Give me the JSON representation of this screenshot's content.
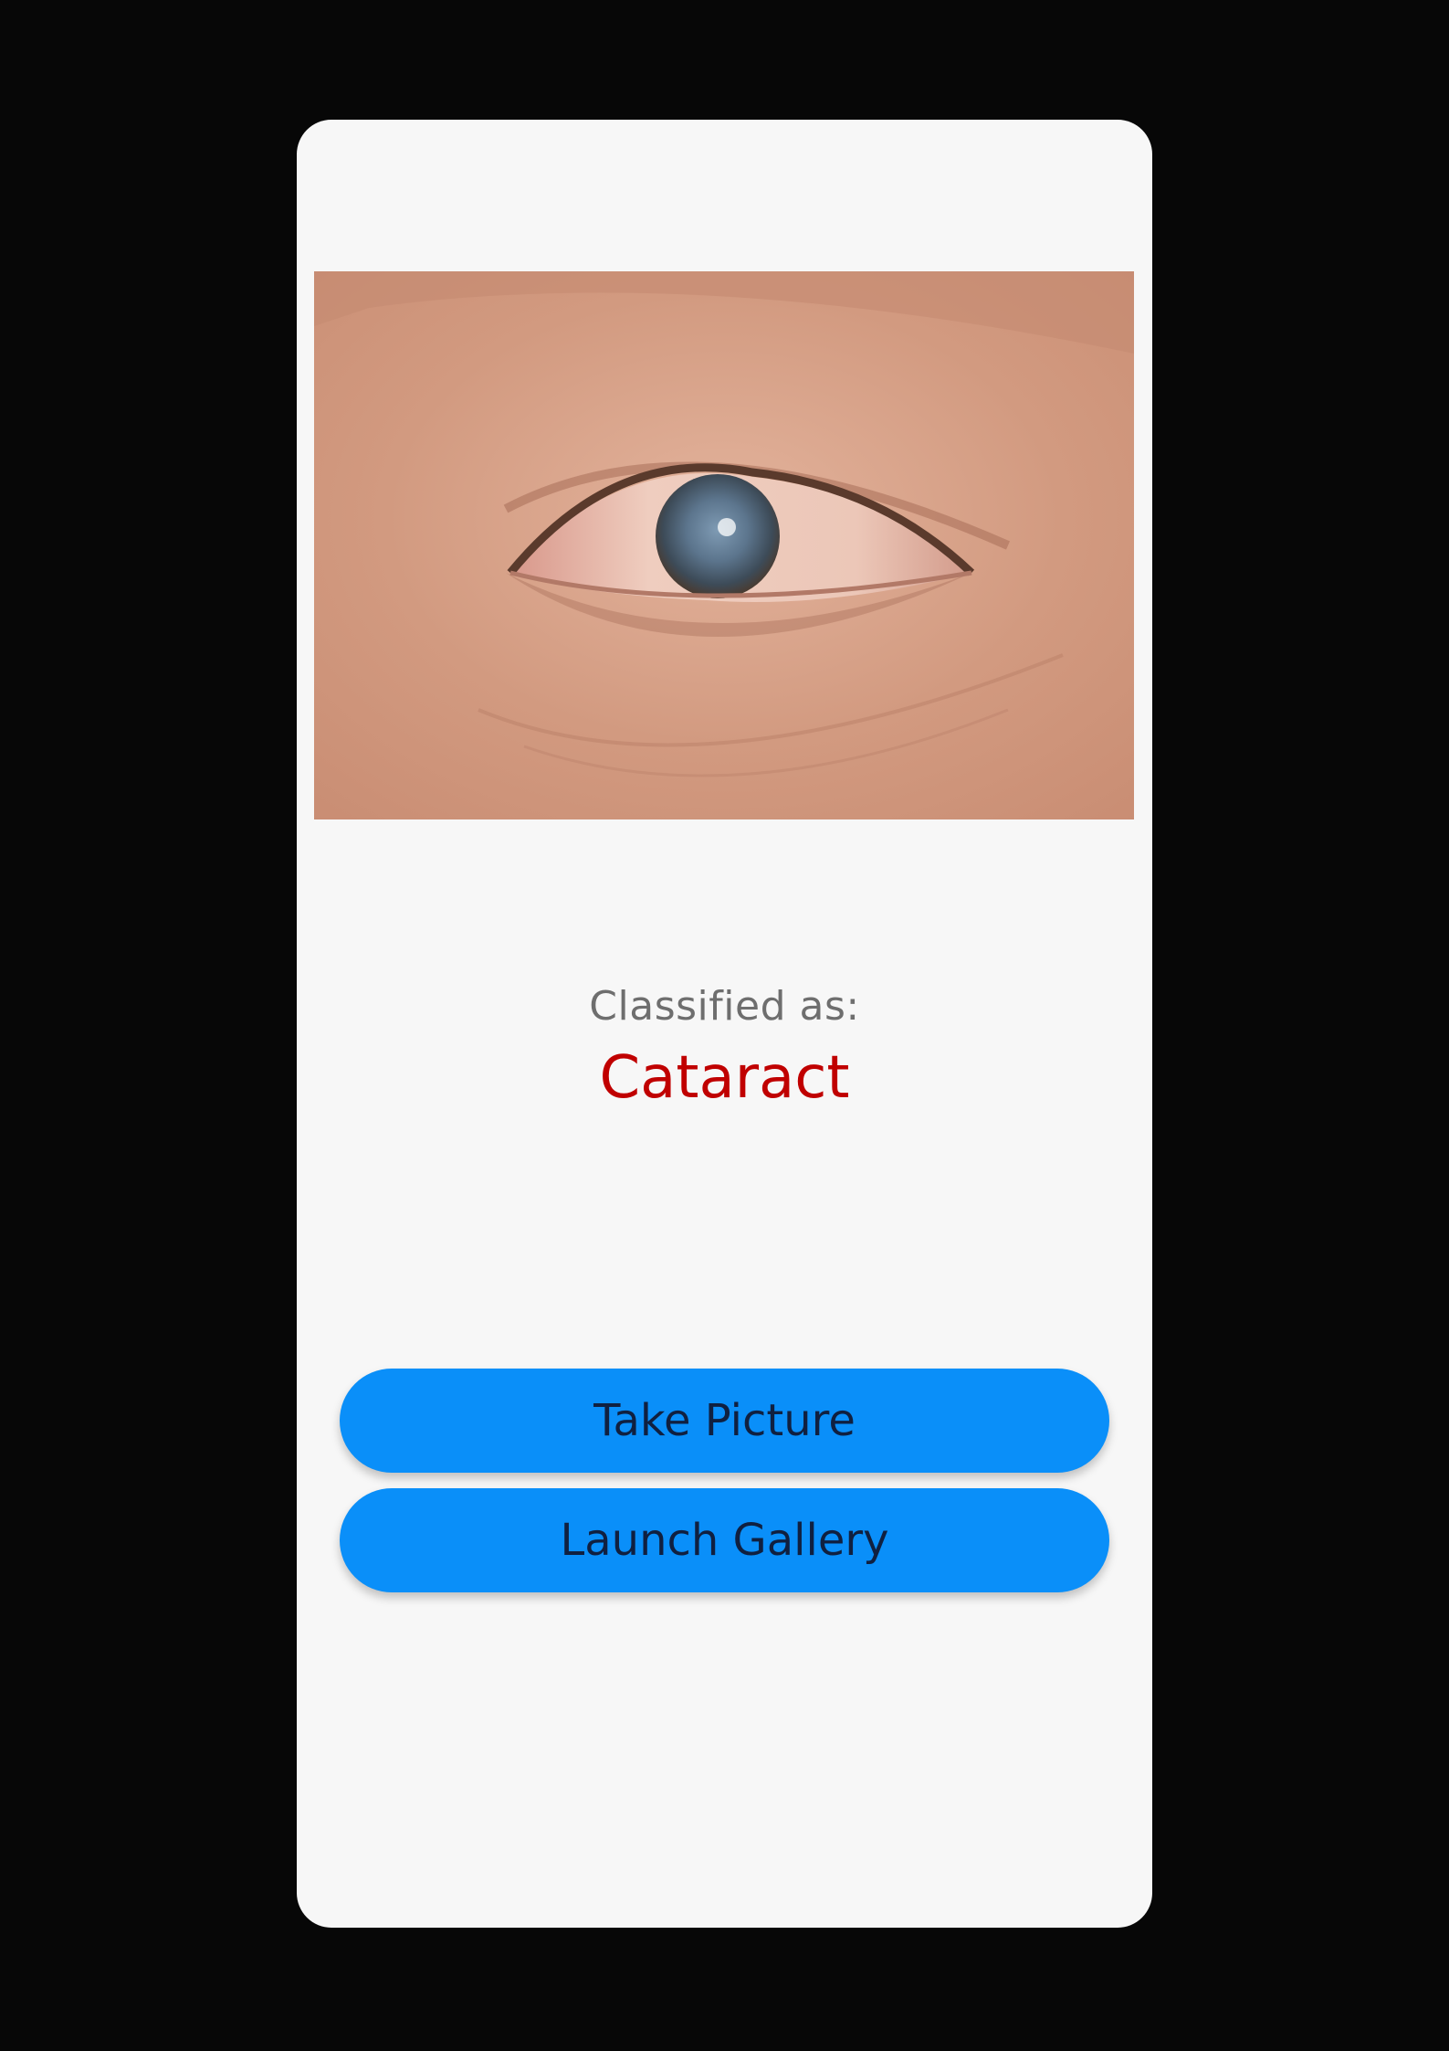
{
  "screen": {
    "image_alt_icon": "eye-photo",
    "result_label": "Classified as:",
    "result_value": "Cataract",
    "result_color": "#c00000"
  },
  "actions": {
    "take_picture_label": "Take Picture",
    "launch_gallery_label": "Launch Gallery",
    "button_color": "#0a8ff9"
  }
}
